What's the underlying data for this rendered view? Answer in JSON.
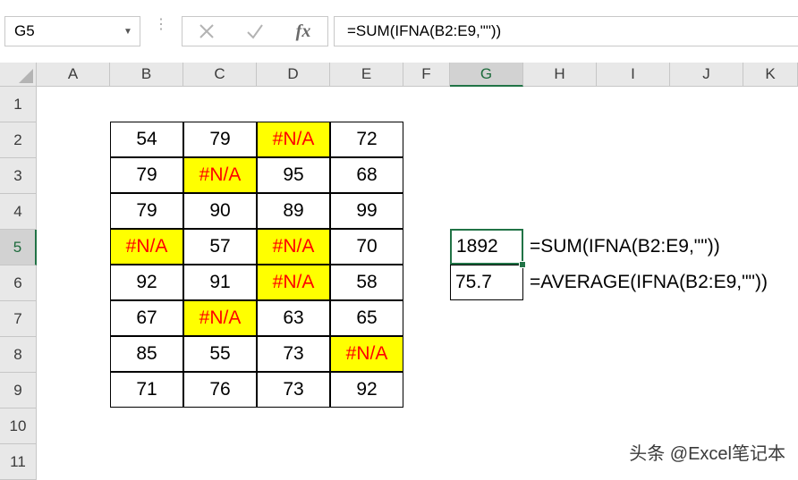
{
  "namebox": {
    "value": "G5"
  },
  "formula_bar": {
    "value": "=SUM(IFNA(B2:E9,\"\"))"
  },
  "icons": {
    "cancel": "close-icon",
    "enter": "check-icon",
    "fx": "fx-icon"
  },
  "fx_symbol": "fx",
  "colors": {
    "accent": "#217346",
    "na_fill": "#ffff00",
    "na_text": "#ff0000"
  },
  "columns": [
    "A",
    "B",
    "C",
    "D",
    "E",
    "F",
    "G",
    "H",
    "I",
    "J",
    "K"
  ],
  "rows": [
    "1",
    "2",
    "3",
    "4",
    "5",
    "6",
    "7",
    "8",
    "9",
    "10",
    "11"
  ],
  "selected_column": "G",
  "selected_row": "5",
  "table": [
    [
      "54",
      "79",
      "#N/A",
      "72"
    ],
    [
      "79",
      "#N/A",
      "95",
      "68"
    ],
    [
      "79",
      "90",
      "89",
      "99"
    ],
    [
      "#N/A",
      "57",
      "#N/A",
      "70"
    ],
    [
      "92",
      "91",
      "#N/A",
      "58"
    ],
    [
      "67",
      "#N/A",
      "63",
      "65"
    ],
    [
      "85",
      "55",
      "73",
      "#N/A"
    ],
    [
      "71",
      "76",
      "73",
      "92"
    ]
  ],
  "results": [
    {
      "cell": "G5",
      "value": "1892",
      "formula_text": "=SUM(IFNA(B2:E9,\"\"))"
    },
    {
      "cell": "G6",
      "value": "75.7",
      "formula_text": "=AVERAGE(IFNA(B2:E9,\"\"))"
    }
  ],
  "watermark": "头条 @Excel笔记本"
}
